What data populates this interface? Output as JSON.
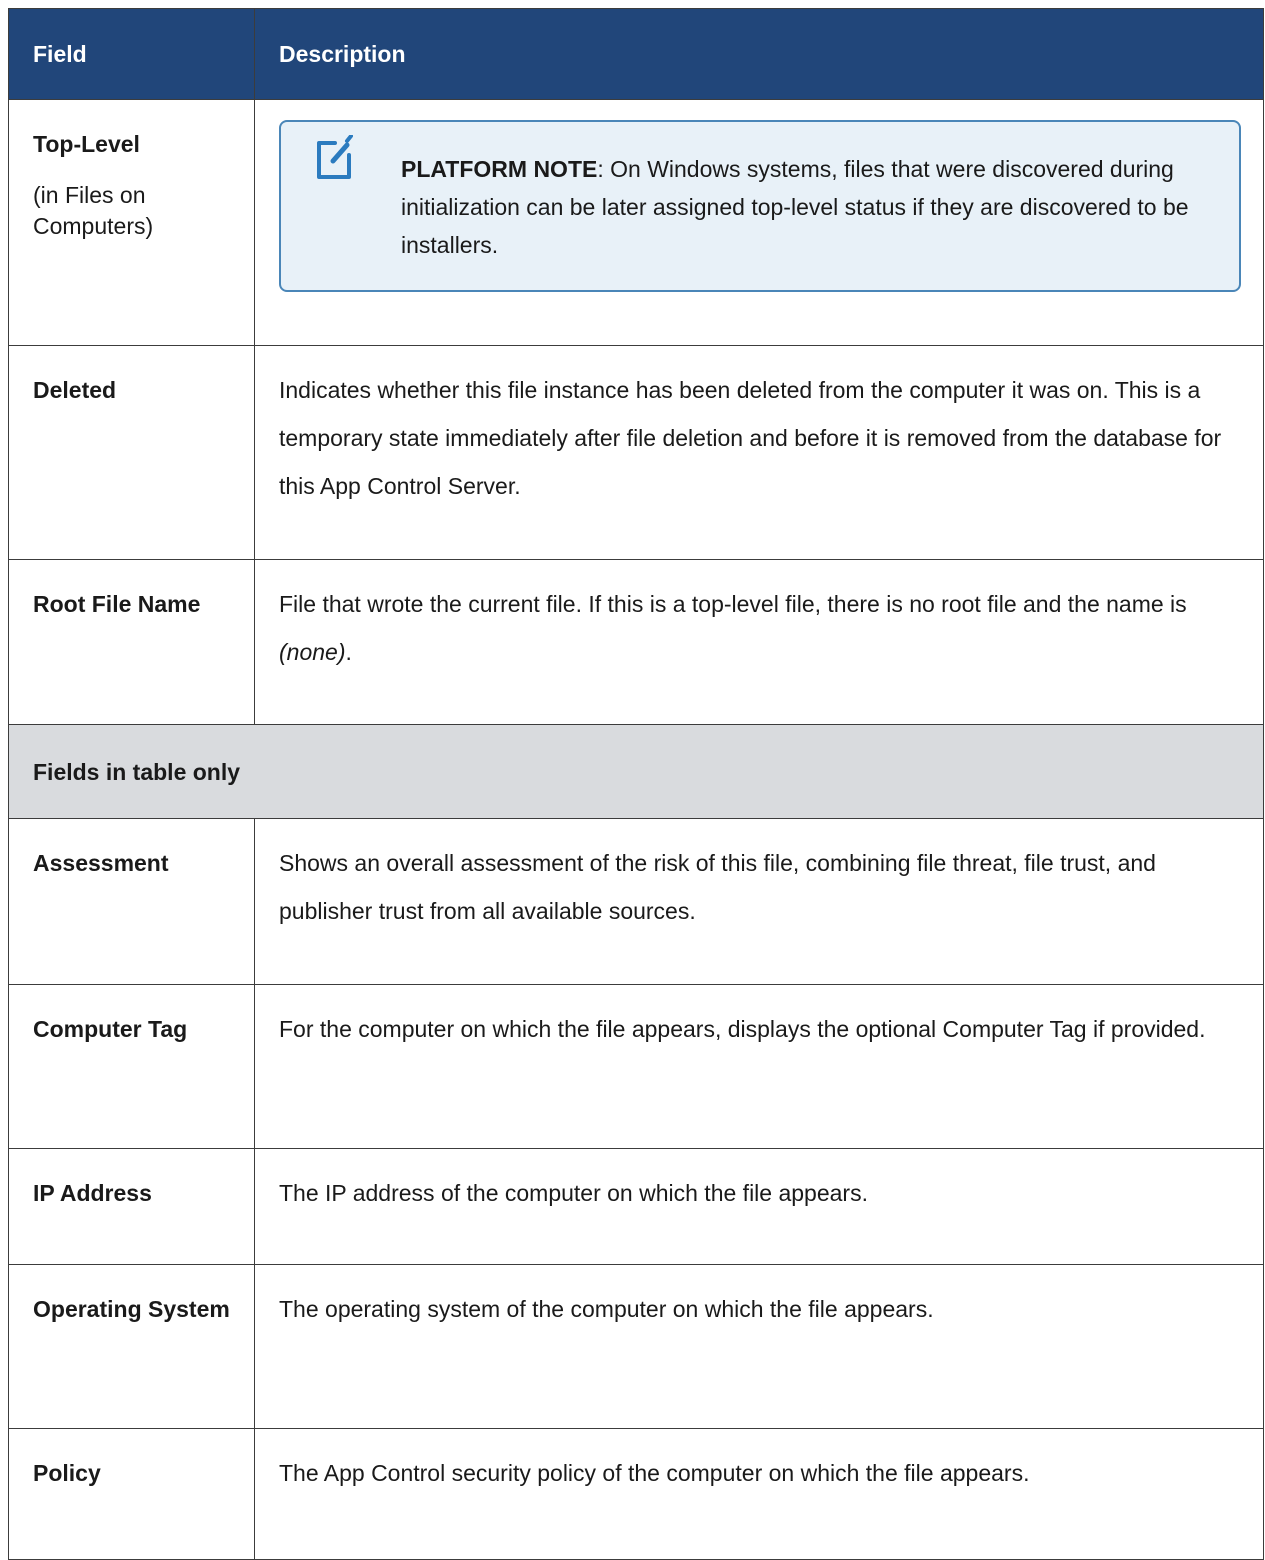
{
  "header": {
    "field": "Field",
    "description": "Description"
  },
  "rows": [
    {
      "field": "Top-Level",
      "field_sub": "(in Files on Computers)",
      "note": {
        "label": "PLATFORM NOTE",
        "text": ": On Windows systems, files that were discovered during initialization can be later assigned top-level status if they are discovered to be installers.",
        "icon": "note-pencil-icon"
      }
    },
    {
      "field": "Deleted",
      "description": "Indicates whether this file instance has been deleted from the computer it was on. This is a temporary state immediately after file deletion and before it is removed from the database for this App Control Server."
    },
    {
      "field": "Root File Name",
      "description_before": "File that wrote the current file. If this is a top-level file, there is no root file and the name is ",
      "description_italic": "(none)",
      "description_after": "."
    }
  ],
  "section": {
    "title": "Fields in table only"
  },
  "table_only_rows": [
    {
      "field": "Assessment",
      "description": "Shows an overall assessment of the risk of this file, combining file threat, file trust, and publisher trust from all available sources."
    },
    {
      "field": "Computer Tag",
      "description": "For the computer on which the file appears, displays the optional Computer Tag if provided."
    },
    {
      "field": "IP Address",
      "description": "The IP address of the computer on which the file appears."
    },
    {
      "field": "Operating System",
      "description": "The operating system of the computer on which the file appears."
    },
    {
      "field": "Policy",
      "description": "The App Control security policy of the computer on which the file appears."
    }
  ],
  "colors": {
    "header_bg": "#21467a",
    "section_bg": "#d9dbde",
    "note_border": "#4a86b8",
    "note_bg": "#e8f1f8"
  }
}
